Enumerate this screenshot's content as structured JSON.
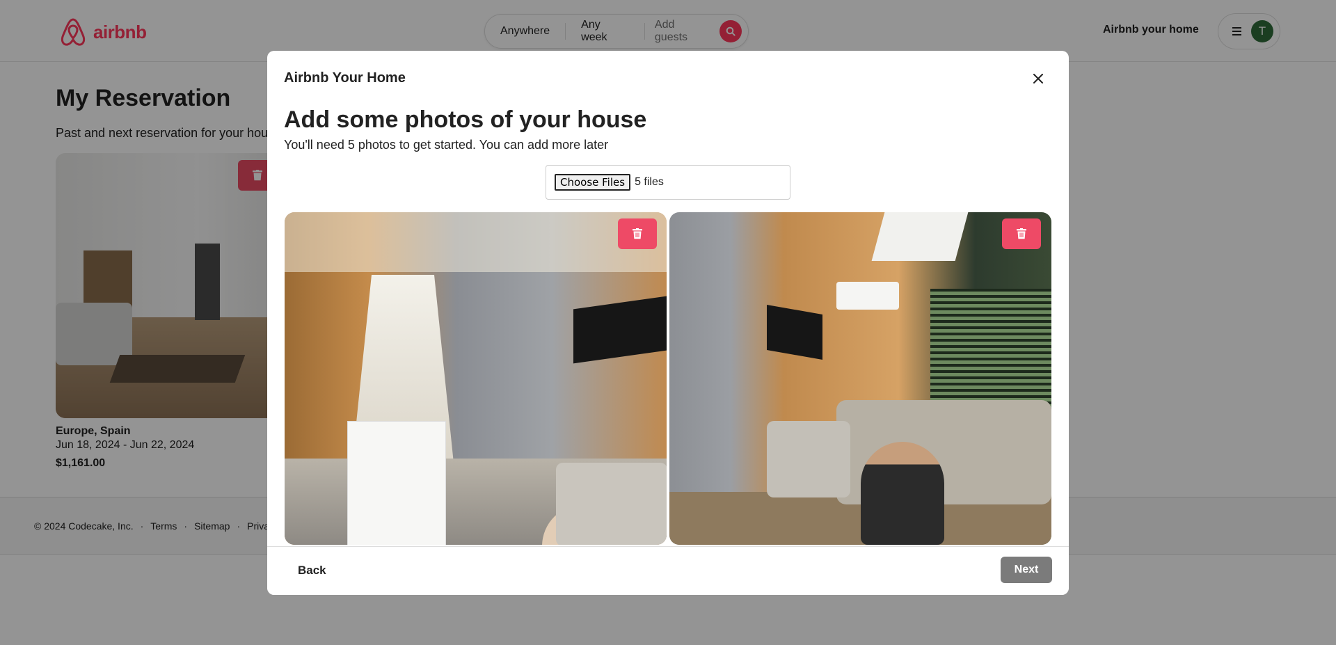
{
  "header": {
    "brand": "airbnb",
    "brand_color": "#ff385c",
    "search": {
      "where": "Anywhere",
      "when": "Any week",
      "guests": "Add guests"
    },
    "host_link": "Airbnb your home",
    "avatar_initial": "T"
  },
  "page": {
    "title": "My Reservation",
    "subtitle": "Past and next reservation for your house"
  },
  "reservation": {
    "location": "Europe, Spain",
    "dates": "Jun 18, 2024 - Jun 22, 2024",
    "price": "$1,161.00"
  },
  "footer": {
    "copyright": "© 2024 Codecake, Inc.",
    "links": [
      "Terms",
      "Sitemap",
      "Privacy"
    ]
  },
  "modal": {
    "title": "Airbnb Your Home",
    "heading": "Add some photos of your house",
    "subheading": "You'll need 5 photos to get started. You can add more later",
    "file_input": {
      "button_label": "Choose Files",
      "status": "5 files"
    },
    "photos": [
      "living-room-corridor",
      "living-room-sofa"
    ],
    "back_label": "Back",
    "next_label": "Next",
    "delete_color": "#ee4a66"
  }
}
